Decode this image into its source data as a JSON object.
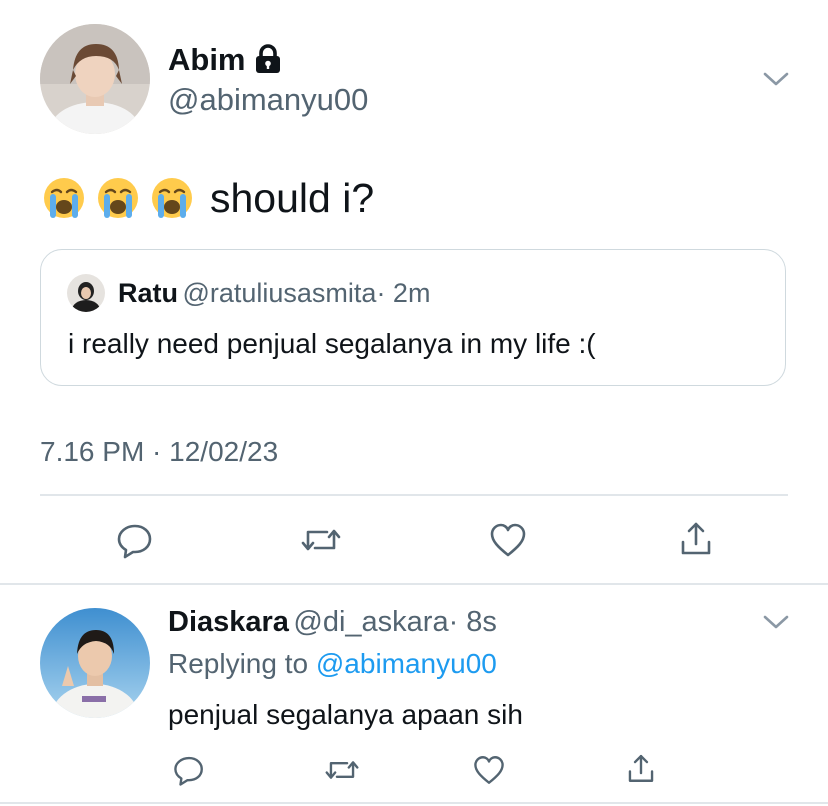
{
  "main_tweet": {
    "author_name": "Abim",
    "author_handle": "@abimanyu00",
    "text": "should i?",
    "emojis": [
      "loudly-crying-face",
      "loudly-crying-face",
      "loudly-crying-face"
    ],
    "timestamp": "7.16 PM · 12/02/23"
  },
  "quoted_tweet": {
    "author_name": "Ratu",
    "author_handle": "@ratuliusasmita",
    "time": "· 2m",
    "text": "i really need penjual segalanya in my life :("
  },
  "reply": {
    "author_name": "Diaskara",
    "author_handle": "@di_askara",
    "time": "· 8s",
    "replying_prefix": "Replying to",
    "replying_to": "@abimanyu00",
    "text": "penjual segalanya apaan sih"
  },
  "colors": {
    "text": "#0f1419",
    "muted": "#536471",
    "link": "#1d9bf0",
    "border": "#cfd9de"
  },
  "icons": [
    "lock-icon",
    "chevron-down-icon",
    "reply-icon",
    "retweet-icon",
    "like-icon",
    "share-icon"
  ]
}
